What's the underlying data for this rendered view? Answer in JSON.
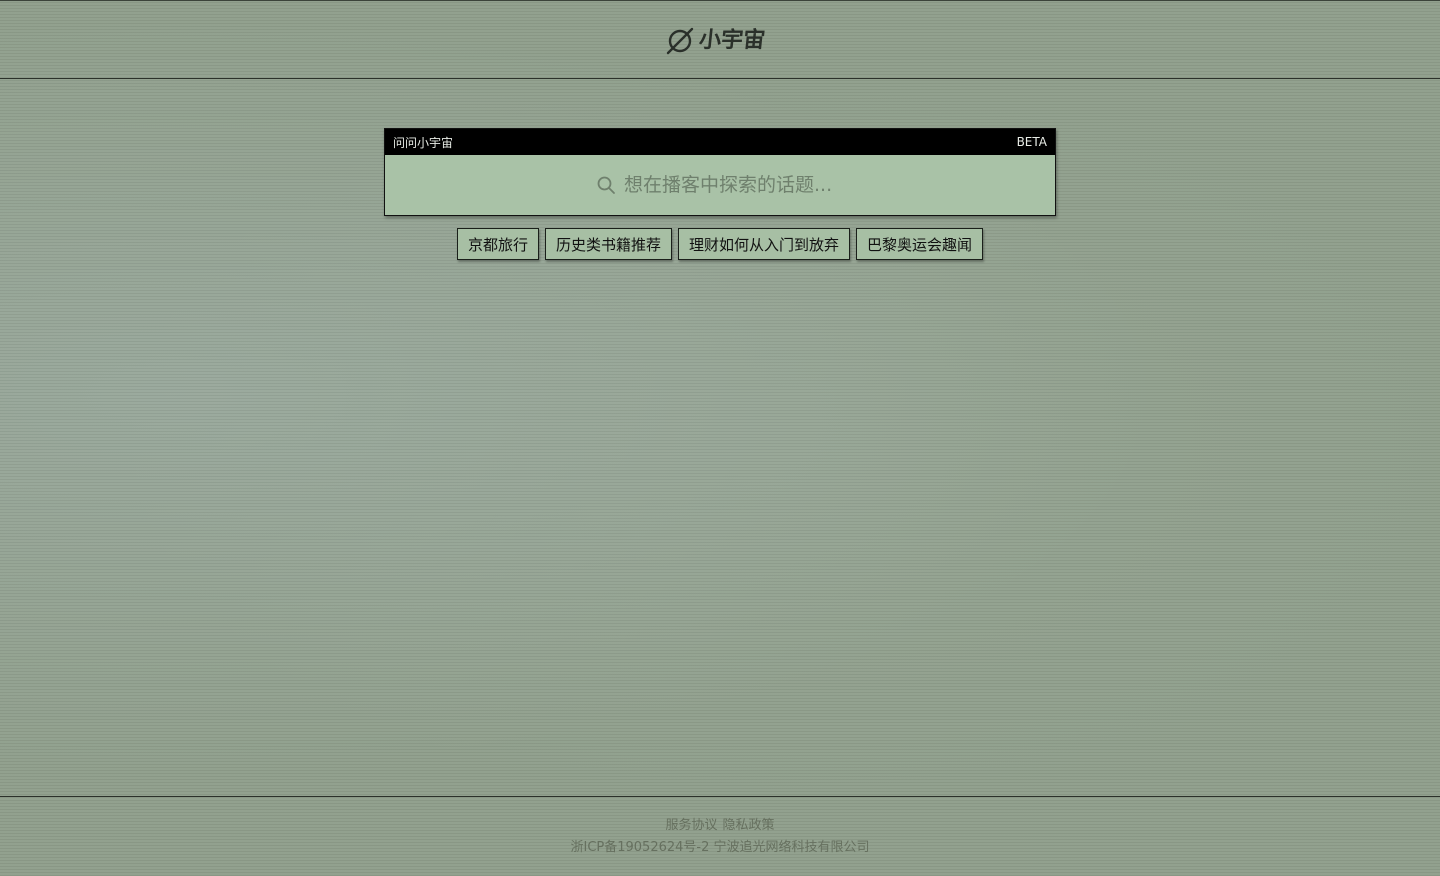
{
  "header": {
    "logo_text": "小宇宙",
    "logo_icon": "planet-icon"
  },
  "ask": {
    "title": "问问小宇宙",
    "badge": "BETA",
    "placeholder": "想在播客中探索的话题...",
    "search_icon": "search-icon"
  },
  "suggestions": [
    {
      "label": "京都旅行"
    },
    {
      "label": "历史类书籍推荐"
    },
    {
      "label": "理财如何从入门到放弃"
    },
    {
      "label": "巴黎奥运会趣闻"
    }
  ],
  "footer": {
    "terms": "服务协议",
    "privacy": "隐私政策",
    "icp": "浙ICP备19052624号-2 宁波追光网络科技有限公司"
  },
  "colors": {
    "background": "#8f9e8b",
    "panel": "#a9c2a7",
    "bar": "#000000",
    "text_dark": "#2a302a"
  }
}
